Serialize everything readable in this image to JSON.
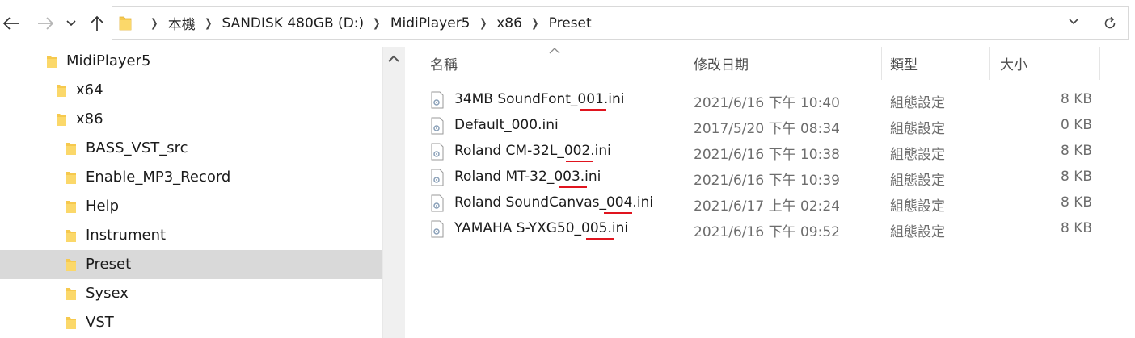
{
  "toolbar": {
    "back_icon": "arrow-left-icon",
    "forward_icon": "arrow-right-icon",
    "recent_icon": "chevron-down-icon",
    "up_icon": "arrow-up-icon",
    "refresh_icon": "refresh-icon"
  },
  "address": {
    "crumbs": [
      "本機",
      "SANDISK 480GB (D:)",
      "MidiPlayer5",
      "x86",
      "Preset"
    ]
  },
  "tree": {
    "items": [
      {
        "label": "MidiPlayer5",
        "selected": false
      },
      {
        "label": "x64",
        "selected": false
      },
      {
        "label": "x86",
        "selected": false
      },
      {
        "label": "BASS_VST_src",
        "selected": false
      },
      {
        "label": "Enable_MP3_Record",
        "selected": false
      },
      {
        "label": "Help",
        "selected": false
      },
      {
        "label": "Instrument",
        "selected": false
      },
      {
        "label": "Preset",
        "selected": true
      },
      {
        "label": "Sysex",
        "selected": false
      },
      {
        "label": "VST",
        "selected": false
      }
    ]
  },
  "columns": {
    "name": "名稱",
    "date": "修改日期",
    "type": "類型",
    "size": "大小"
  },
  "files": [
    {
      "name": "34MB SoundFont_001.ini",
      "date": "2021/6/16 下午 10:40",
      "type": "組態設定",
      "size": "8 KB",
      "annotated": true
    },
    {
      "name": "Default_000.ini",
      "date": "2017/5/20 下午 08:34",
      "type": "組態設定",
      "size": "0 KB",
      "annotated": false
    },
    {
      "name": "Roland CM-32L_002.ini",
      "date": "2021/6/16 下午 10:38",
      "type": "組態設定",
      "size": "8 KB",
      "annotated": true
    },
    {
      "name": "Roland MT-32_003.ini",
      "date": "2021/6/16 下午 10:39",
      "type": "組態設定",
      "size": "8 KB",
      "annotated": true
    },
    {
      "name": "Roland SoundCanvas_004.ini",
      "date": "2021/6/17 上午 02:24",
      "type": "組態設定",
      "size": "8 KB",
      "annotated": true
    },
    {
      "name": "YAMAHA S-YXG50_005.ini",
      "date": "2021/6/16 下午 09:52",
      "type": "組態設定",
      "size": "8 KB",
      "annotated": true
    }
  ],
  "colors": {
    "folder": "#f6c94e",
    "selection": "#d9d9d9",
    "annotation_underline": "#e0141e"
  }
}
